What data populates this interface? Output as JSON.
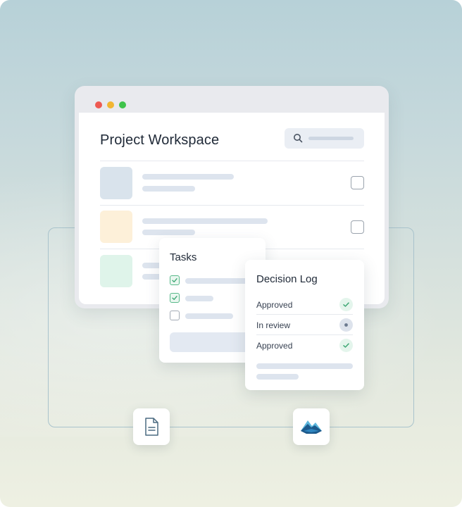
{
  "window": {
    "title": "Project Workspace",
    "controls": [
      "close",
      "minimize",
      "maximize"
    ]
  },
  "workspace": {
    "rows": [
      {
        "thumb_color": "#d9e3ec"
      },
      {
        "thumb_color": "#fdf0d9"
      },
      {
        "thumb_color": "#dff4ea"
      }
    ]
  },
  "tasks": {
    "title": "Tasks",
    "items": [
      {
        "checked": true
      },
      {
        "checked": true
      },
      {
        "checked": false
      }
    ]
  },
  "decision_log": {
    "title": "Decision Log",
    "items": [
      {
        "label": "Approved",
        "status_icon": "check-icon"
      },
      {
        "label": "In review",
        "status_icon": "pending-dot-icon"
      },
      {
        "label": "Approved",
        "status_icon": "check-icon"
      }
    ]
  },
  "integrations": [
    {
      "icon": "document-icon"
    },
    {
      "icon": "mountain-logo-icon"
    }
  ],
  "colors": {
    "accent_green": "#59b98a",
    "line_placeholder": "#dde4ee",
    "mountain_dark": "#1d5a8c",
    "mountain_light": "#5bb6dc"
  }
}
